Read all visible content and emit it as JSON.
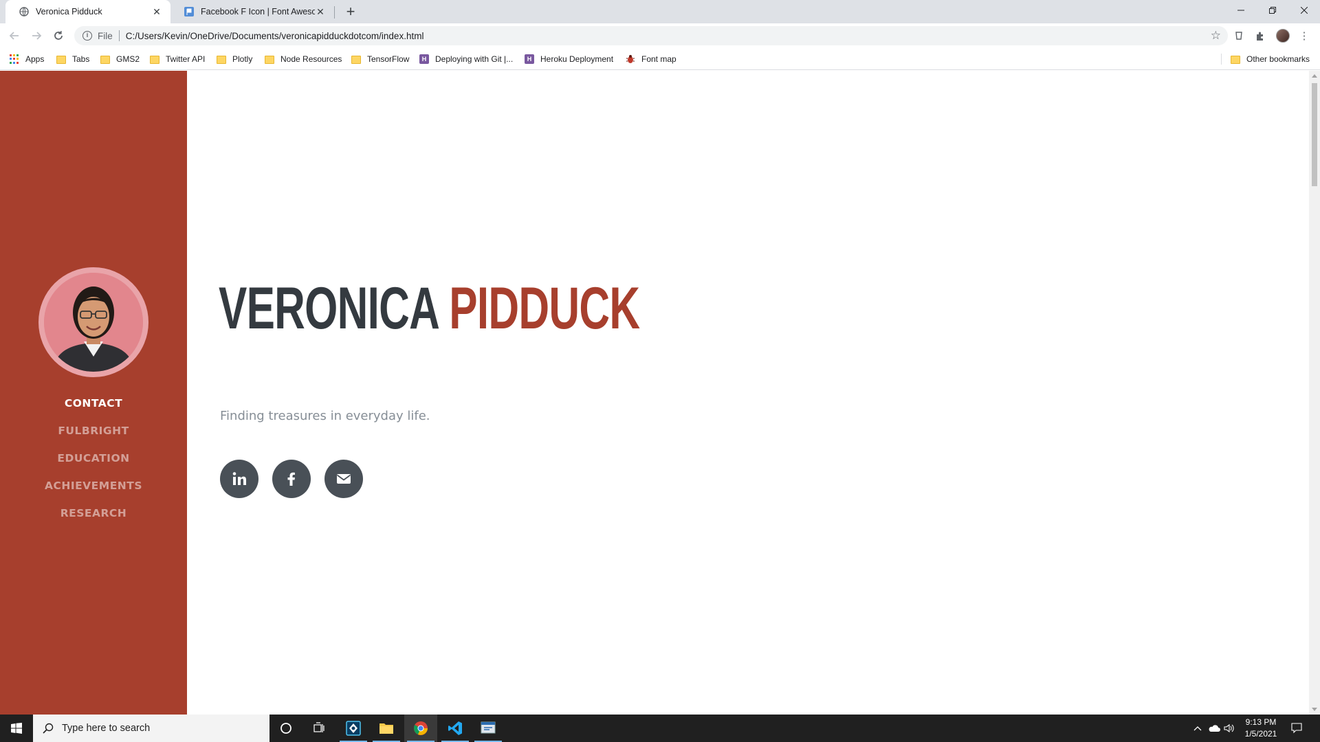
{
  "browser": {
    "tabs": [
      {
        "title": "Veronica Pidduck",
        "active": true,
        "icon": "globe-icon"
      },
      {
        "title": "Facebook F Icon | Font Awesome",
        "active": false,
        "icon": "font-awesome-flag-icon"
      }
    ],
    "address": {
      "scheme": "File",
      "url": "C:/Users/Kevin/OneDrive/Documents/veronicapidduckdotcom/index.html"
    },
    "bookmarks": [
      {
        "label": "Apps",
        "icon": "apps-grid-icon"
      },
      {
        "label": "Tabs",
        "icon": "folder-icon"
      },
      {
        "label": "GMS2",
        "icon": "folder-icon"
      },
      {
        "label": "Twitter API",
        "icon": "folder-icon"
      },
      {
        "label": "Plotly",
        "icon": "folder-icon"
      },
      {
        "label": "Node Resources",
        "icon": "folder-icon"
      },
      {
        "label": "TensorFlow",
        "icon": "folder-icon"
      },
      {
        "label": "Deploying with Git |...",
        "icon": "heroku-icon"
      },
      {
        "label": "Heroku Deployment",
        "icon": "heroku-icon"
      },
      {
        "label": "Font map",
        "icon": "bug-icon"
      }
    ],
    "other_bookmarks": "Other bookmarks"
  },
  "page": {
    "sidebar": {
      "accent_color": "#a73f2d",
      "nav": [
        {
          "label": "CONTACT",
          "active": true
        },
        {
          "label": "FULBRIGHT",
          "active": false
        },
        {
          "label": "EDUCATION",
          "active": false
        },
        {
          "label": "ACHIEVEMENTS",
          "active": false
        },
        {
          "label": "RESEARCH",
          "active": false
        }
      ]
    },
    "heading": {
      "first": "VERONICA",
      "last": "PIDDUCK"
    },
    "subheading": "Finding treasures in everyday life.",
    "social": [
      {
        "name": "linkedin-icon",
        "glyph": "in"
      },
      {
        "name": "facebook-icon",
        "glyph": "f"
      },
      {
        "name": "envelope-icon",
        "glyph": "mail"
      }
    ]
  },
  "taskbar": {
    "search_placeholder": "Type here to search",
    "time": "9:13 PM",
    "date": "1/5/2021"
  }
}
